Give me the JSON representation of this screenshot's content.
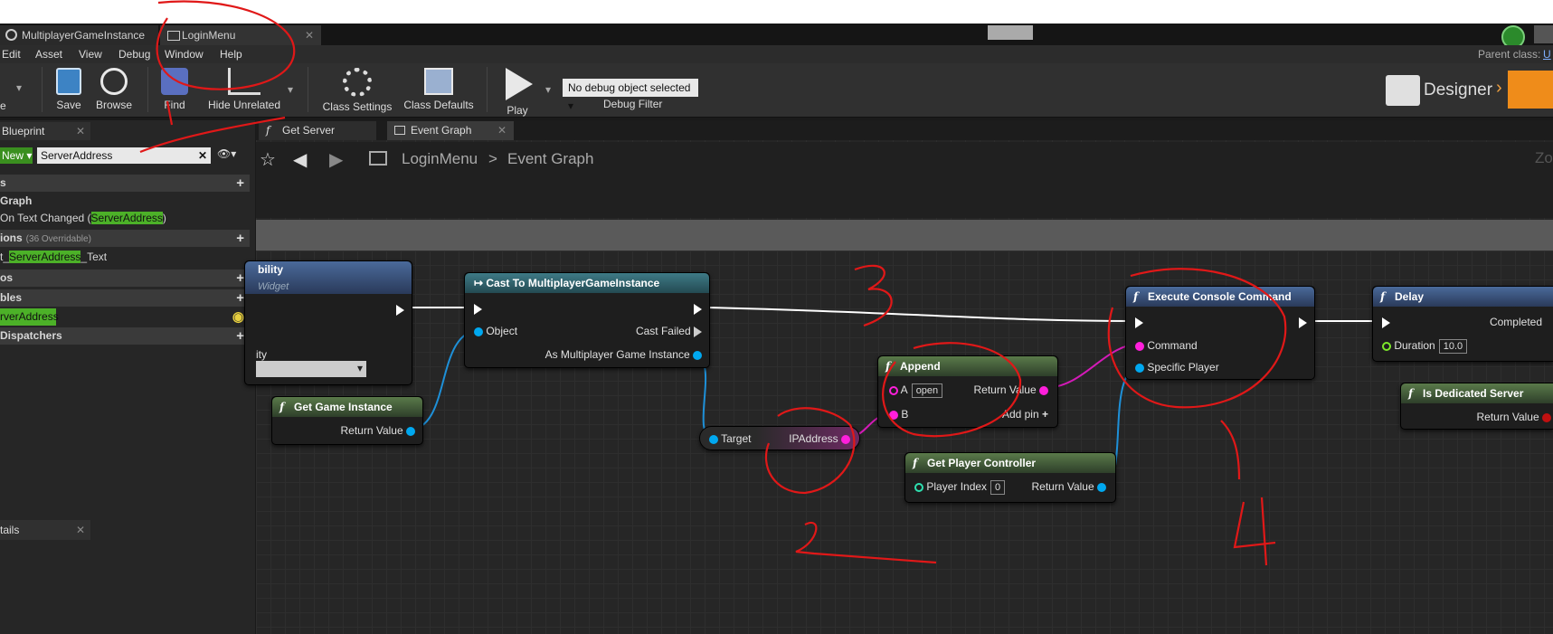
{
  "tabs": [
    {
      "label": "MultiplayerGameInstance"
    },
    {
      "label": "LoginMenu"
    }
  ],
  "menu": [
    "Edit",
    "Asset",
    "View",
    "Debug",
    "Window",
    "Help"
  ],
  "parent_class": {
    "label": "Parent class:",
    "value": "U"
  },
  "toolbar": {
    "buttons": [
      {
        "label": "Save"
      },
      {
        "label": "Browse"
      },
      {
        "label": "Find"
      },
      {
        "label": "Hide Unrelated"
      },
      {
        "label": "Class Settings"
      },
      {
        "label": "Class Defaults"
      },
      {
        "label": "Play"
      }
    ],
    "debug_dropdown": "No debug object selected",
    "debug_filter": "Debug Filter",
    "designer": "Designer"
  },
  "left": {
    "tab": "Blueprint",
    "new_label": "New",
    "search_value": "ServerAddress",
    "rows": [
      {
        "text": "s",
        "hdr": true
      },
      {
        "text": "Graph",
        "hdr": false,
        "bold": true
      },
      {
        "pre": "On Text Changed (",
        "hl": "ServerAddress",
        "post": ")"
      },
      {
        "text": "ions",
        "extra": "(36 Overridable)",
        "hdr": true
      },
      {
        "pre": "t_",
        "hl": "ServerAddress",
        "post": "_Text"
      },
      {
        "text": "os",
        "hdr": true
      },
      {
        "text": "bles",
        "hdr": true
      },
      {
        "pre": "",
        "hl": "rverAddress",
        "post": ""
      },
      {
        "text": "Dispatchers",
        "hdr": true
      }
    ],
    "details_tab": "tails"
  },
  "graph_tabs": [
    {
      "label": "Get Server Address"
    },
    {
      "label": "Event Graph"
    }
  ],
  "breadcrumb": {
    "root": "LoginMenu",
    "sep": ">",
    "current": "Event Graph",
    "zoom": "Zo"
  },
  "nodes": {
    "ability": {
      "title": "bility",
      "sub": "Widget",
      "pin": "ity"
    },
    "get_game_instance": {
      "title": "Get Game Instance",
      "out": "Return Value"
    },
    "cast": {
      "title": "Cast To MultiplayerGameInstance",
      "object": "Object",
      "cast_failed": "Cast Failed",
      "as": "As Multiplayer Game Instance"
    },
    "var_node": {
      "target": "Target",
      "out": "IPAddress"
    },
    "append": {
      "title": "Append",
      "a": "A",
      "a_val": "open",
      "b": "B",
      "out": "Return Value",
      "add_pin": "Add pin"
    },
    "get_pc": {
      "title": "Get Player Controller",
      "in": "Player Index",
      "in_val": "0",
      "out": "Return Value"
    },
    "exec_cmd": {
      "title": "Execute Console Command",
      "command": "Command",
      "player": "Specific Player"
    },
    "delay": {
      "title": "Delay",
      "completed": "Completed",
      "duration": "Duration",
      "duration_val": "10.0"
    },
    "dedicated": {
      "title": "Is Dedicated Server",
      "out": "Return Value"
    }
  },
  "annotations": [
    "1",
    "2",
    "3",
    "4"
  ],
  "colors": {
    "string_pin": "#ff1fdb",
    "object_pin": "#00a8f0",
    "exec": "#ffffff",
    "highlight": "#4cb128",
    "bool_pin": "#c01010",
    "float_pin": "#7de82a"
  }
}
